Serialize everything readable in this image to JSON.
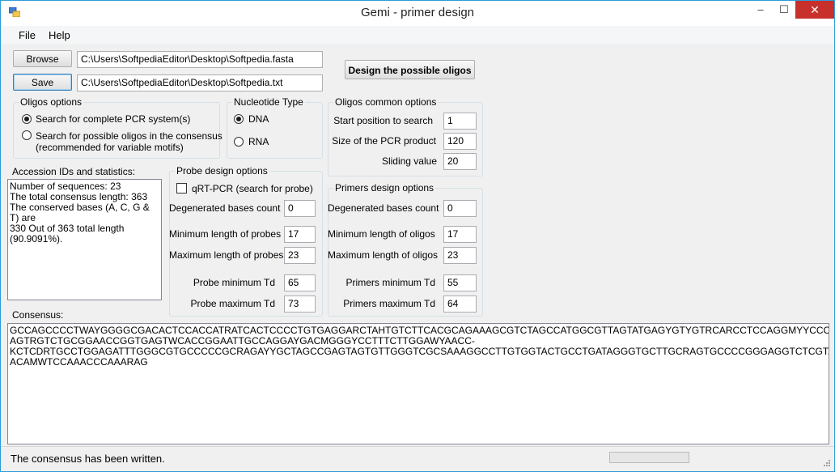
{
  "window": {
    "title": "Gemi - primer design"
  },
  "titlebar": {
    "minimize_glyph": "–",
    "maximize_glyph": "☐",
    "close_glyph": "✕"
  },
  "menu": [
    "File",
    "Help"
  ],
  "file_row": {
    "browse_label": "Browse",
    "save_label": "Save",
    "fasta_path": "C:\\Users\\SoftpediaEditor\\Desktop\\Softpedia.fasta",
    "txt_path": "C:\\Users\\SoftpediaEditor\\Desktop\\Softpedia.txt"
  },
  "design_button_label": "Design the possible oligos",
  "oligos_options": {
    "title": "Oligos options",
    "options": [
      "Search for complete PCR system(s)",
      "Search for possible oligos in the consensus",
      "(recommended for variable motifs)"
    ],
    "selected_index": 0
  },
  "nucleotide_type": {
    "title": "Nucleotide Type",
    "options": [
      "DNA",
      "RNA"
    ],
    "selected_index": 0
  },
  "common_options": {
    "title": "Oligos common options",
    "start_label": "Start position to search",
    "start_value": "1",
    "size_label": "Size of the PCR product",
    "size_value": "120",
    "sliding_label": "Sliding value",
    "sliding_value": "20"
  },
  "accession": {
    "title": "Accession IDs and statistics:",
    "lines": [
      "Number of sequences: 23",
      "The total consensus length: 363",
      "The conserved bases (A, C, G & T) are",
      "330 Out of 363 total length (90.9091%)."
    ]
  },
  "probe": {
    "title": "Probe design options",
    "qrt_label": "qRT-PCR (search for probe)",
    "qrt_checked": false,
    "degenerated_label": "Degenerated bases count",
    "degenerated_value": "0",
    "min_len_label": "Minimum length of probes",
    "min_len_value": "17",
    "max_len_label": "Maximum length of probes",
    "max_len_value": "23",
    "min_td_label": "Probe minimum Td",
    "min_td_value": "65",
    "max_td_label": "Probe maximum Td",
    "max_td_value": "73"
  },
  "primers": {
    "title": "Primers design options",
    "degenerated_label": "Degenerated bases count",
    "degenerated_value": "0",
    "min_len_label": "Minimum length of oligos",
    "min_len_value": "17",
    "max_len_label": "Maximum length of oligos",
    "max_len_value": "23",
    "min_td_label": "Primers minimum Td",
    "min_td_value": "55",
    "max_td_label": "Primers maximum Td",
    "max_td_value": "64"
  },
  "consensus": {
    "label": "Consensus:",
    "lines": [
      "GCCAGCCCCTWAYGGGGCGACACTCCACCATRATCACTCCCCTGTGAGGARCTAHTGTCTTCACGCAGAAAGCGTCTAGCCATGGCGTTAGTATGAGYGTYGTRCARCCTCCAGGMYYCCCCCTCCCGGGAGRSCCAT",
      "AGTRGTCTGCGGAACCGGTGAGTWCACCGGAATTGCCAGGAYGACMGGGYCCTTTCTTGGAWYAACC-",
      "KCTCDRTGCCTGGAGATTTGGGCGTGCCCCCGCRAGAYYGCTAGCCGAGTAGTGTTGGGTCGCSAAAGGCCTTGTGGTACTGCCTGATAGGGTGCTTGCRAGTGCCCCGGGAGGTCTCGTAGACCGTGCACATGAGC",
      "ACAMWTCCAAACCCAAARAG"
    ]
  },
  "status": {
    "text": "The consensus has been written.",
    "progress": 0
  },
  "colors": {
    "close_button": "#c7302b",
    "accent_border": "#2b9bd8",
    "progress_fill": "#06b025"
  }
}
